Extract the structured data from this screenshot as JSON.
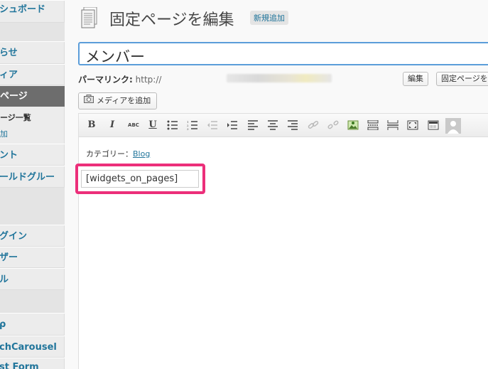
{
  "sidebar": {
    "items": [
      {
        "label": "シュボード"
      },
      {
        "label": "らせ"
      },
      {
        "label": "ィア"
      },
      {
        "label": "ページ",
        "active": true
      },
      {
        "label": "ント"
      },
      {
        "label": "ールドグルー"
      },
      {
        "label": "グイン"
      },
      {
        "label": "ザー"
      },
      {
        "label": "ル"
      },
      {
        "label": "ρ"
      },
      {
        "label": "chCarousel"
      },
      {
        "label": "st Form"
      }
    ],
    "subitems": [
      {
        "label": "ージ一覧"
      },
      {
        "label": "加"
      }
    ]
  },
  "header": {
    "title": "固定ページを編集",
    "add_new": "新規追加"
  },
  "title_input": {
    "value": "メンバー"
  },
  "permalink": {
    "label": "パーマリンク:",
    "prefix": "http://",
    "edit_button": "編集",
    "view_button": "固定ページを表示"
  },
  "media": {
    "add_button": "メディアを追加"
  },
  "toolbar": {
    "buttons": [
      {
        "icon": "bold-icon",
        "glyph": "B"
      },
      {
        "icon": "italic-icon",
        "glyph": "I"
      },
      {
        "icon": "strikethrough-icon",
        "glyph": "ABC"
      },
      {
        "icon": "underline-icon",
        "glyph": "U"
      },
      {
        "icon": "bullet-list-icon"
      },
      {
        "icon": "numbered-list-icon"
      },
      {
        "icon": "outdent-icon"
      },
      {
        "icon": "indent-icon"
      },
      {
        "icon": "align-left-icon"
      },
      {
        "icon": "align-center-icon"
      },
      {
        "icon": "align-right-icon"
      },
      {
        "icon": "link-icon"
      },
      {
        "icon": "unlink-icon"
      },
      {
        "icon": "image-icon"
      },
      {
        "icon": "more-tag-icon"
      },
      {
        "icon": "page-break-icon"
      },
      {
        "icon": "fullscreen-icon"
      },
      {
        "icon": "kitchen-sink-icon"
      },
      {
        "icon": "avatar-icon"
      }
    ]
  },
  "content": {
    "category_label": "カテゴリー：",
    "category_link": "Blog",
    "shortcode": "[widgets_on_pages]"
  },
  "colors": {
    "highlight": "#ec2f7a",
    "link": "#21759b",
    "focus": "#5b9dd9"
  }
}
